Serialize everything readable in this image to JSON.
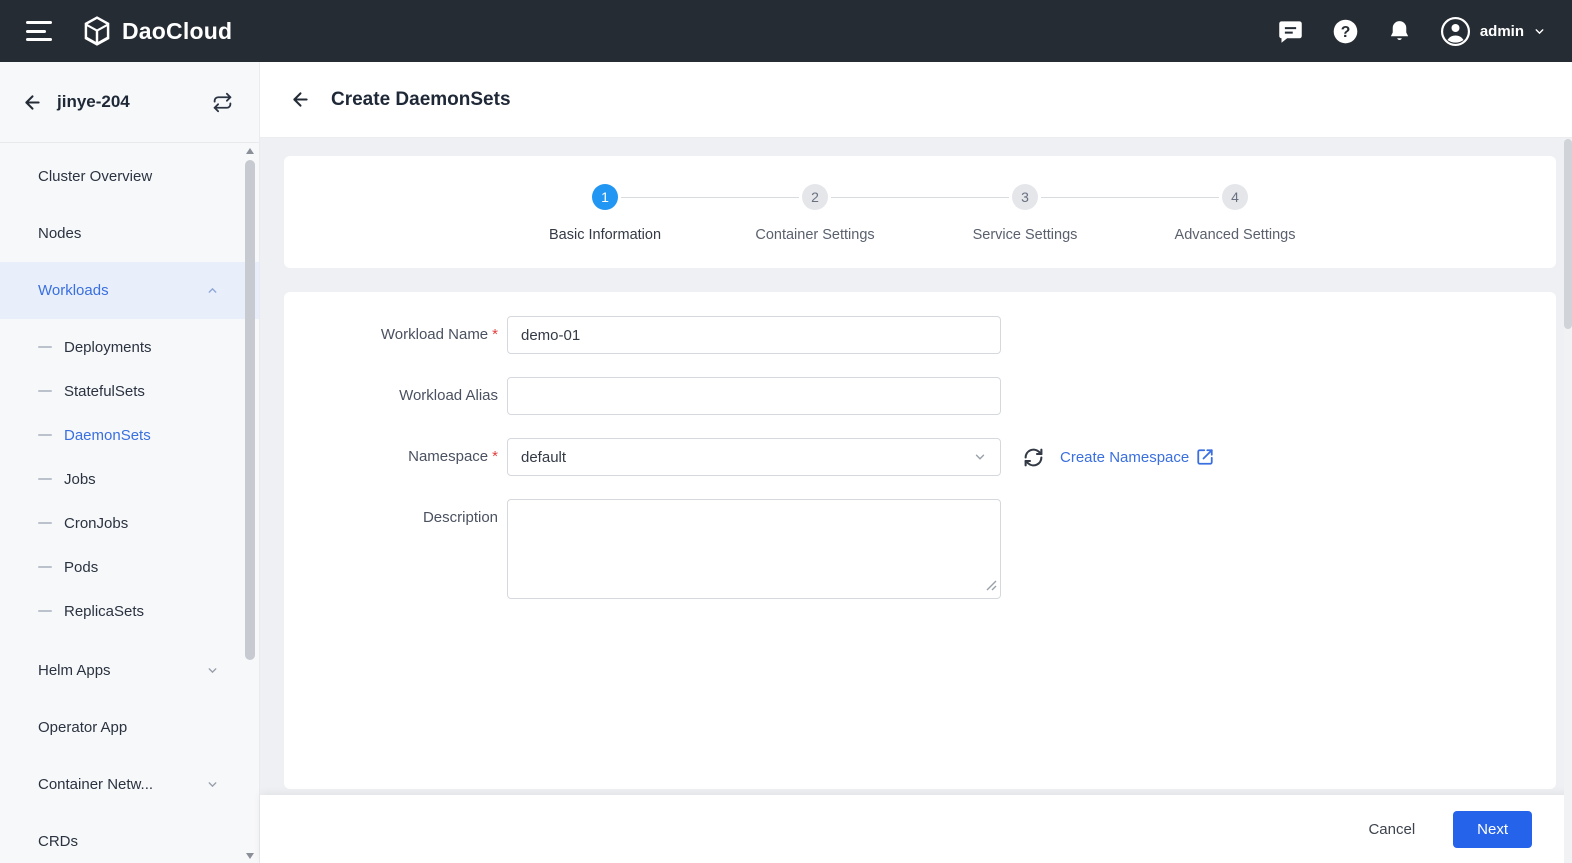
{
  "topbar": {
    "brand": "DaoCloud",
    "user": "admin"
  },
  "sidebar": {
    "cluster_name": "jinye-204",
    "items": [
      {
        "label": "Cluster Overview",
        "type": "top"
      },
      {
        "label": "Nodes",
        "type": "top"
      },
      {
        "label": "Workloads",
        "type": "top",
        "expanded": true,
        "active": true
      },
      {
        "label": "Deployments",
        "type": "sub"
      },
      {
        "label": "StatefulSets",
        "type": "sub"
      },
      {
        "label": "DaemonSets",
        "type": "sub",
        "selected": true
      },
      {
        "label": "Jobs",
        "type": "sub"
      },
      {
        "label": "CronJobs",
        "type": "sub"
      },
      {
        "label": "Pods",
        "type": "sub"
      },
      {
        "label": "ReplicaSets",
        "type": "sub"
      },
      {
        "label": "Helm Apps",
        "type": "top",
        "collapsed": true
      },
      {
        "label": "Operator App",
        "type": "top"
      },
      {
        "label": "Container Netw...",
        "type": "top",
        "collapsed": true
      },
      {
        "label": "CRDs",
        "type": "top"
      }
    ]
  },
  "page": {
    "title": "Create DaemonSets"
  },
  "steps": [
    {
      "num": "1",
      "label": "Basic Information",
      "current": true
    },
    {
      "num": "2",
      "label": "Container Settings"
    },
    {
      "num": "3",
      "label": "Service Settings"
    },
    {
      "num": "4",
      "label": "Advanced Settings"
    }
  ],
  "form": {
    "required_mark": "*",
    "workload_name": {
      "label": "Workload Name",
      "required": true,
      "value": "demo-01"
    },
    "workload_alias": {
      "label": "Workload Alias",
      "value": ""
    },
    "namespace": {
      "label": "Namespace",
      "required": true,
      "value": "default",
      "link_label": "Create Namespace"
    },
    "description": {
      "label": "Description",
      "value": ""
    }
  },
  "footer": {
    "cancel": "Cancel",
    "next": "Next"
  },
  "icons": {
    "menu": "hamburger",
    "chat": "speech-bubble",
    "help": "?",
    "bell": "bell",
    "avatar": "person-circle",
    "chevron_down": "⌄",
    "chevron_up": "⌃",
    "back": "←",
    "switch_cluster": "repeat-arrows",
    "refresh": "circular-arrows",
    "external_link": "box-with-arrow",
    "sub_item_dash": "—"
  },
  "colors": {
    "accent": "#3a6fe0",
    "step_active": "#2196f3",
    "primary_button": "#2563eb",
    "topbar_bg": "#262c33",
    "required": "#e0403f"
  }
}
